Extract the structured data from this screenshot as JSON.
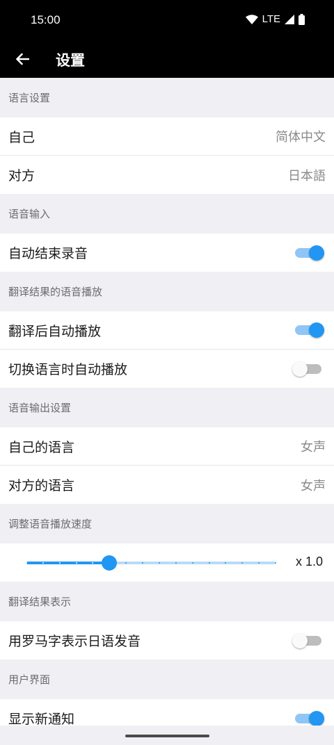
{
  "status_bar": {
    "time": "15:00",
    "network": "LTE"
  },
  "app_bar": {
    "title": "设置"
  },
  "sections": {
    "language": {
      "header": "语言设置",
      "self_label": "自己",
      "self_value": "简体中文",
      "partner_label": "对方",
      "partner_value": "日本語"
    },
    "voice_input": {
      "header": "语音输入",
      "auto_stop_label": "自动结束录音",
      "auto_stop_on": true
    },
    "playback": {
      "header": "翻译结果的语音播放",
      "auto_play_label": "翻译后自动播放",
      "auto_play_on": true,
      "switch_play_label": "切换语言时自动播放",
      "switch_play_on": false
    },
    "voice_output": {
      "header": "语音输出设置",
      "self_lang_label": "自己的语言",
      "self_lang_value": "女声",
      "partner_lang_label": "对方的语言",
      "partner_lang_value": "女声"
    },
    "speed": {
      "header": "调整语音播放速度",
      "value_label": "x 1.0",
      "level_fraction": 0.333,
      "steps": 15
    },
    "result_display": {
      "header": "翻译结果表示",
      "romaji_label": "用罗马字表示日语发音",
      "romaji_on": false
    },
    "ui": {
      "header": "用户界面",
      "notify_label": "显示新通知",
      "notify_on": true
    }
  },
  "colors": {
    "accent": "#2196f3",
    "accent_light": "#90c6f5",
    "background": "#efeff4"
  }
}
